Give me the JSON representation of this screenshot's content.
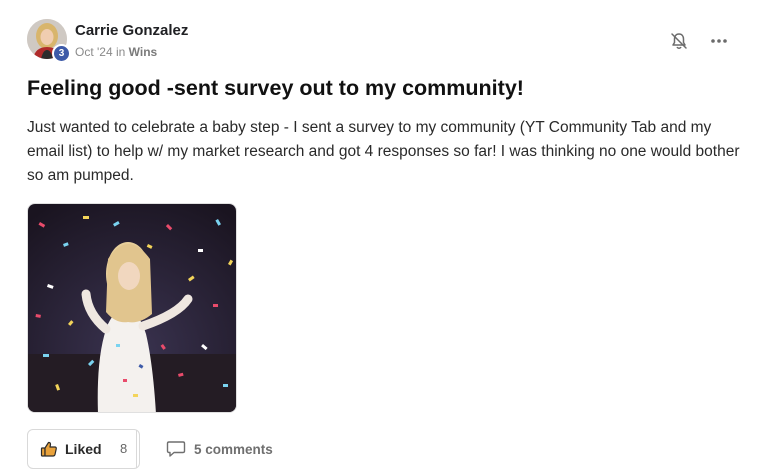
{
  "post": {
    "author": "Carrie Gonzalez",
    "level": "3",
    "date": "Oct '24",
    "in_word": "in",
    "category": "Wins",
    "title": "Feeling good -sent survey out to my community!",
    "body": "Just wanted to celebrate a baby step - I sent a survey to my community (YT Community Tab and my email list) to help w/ my market research and got 4 responses so far! I was thinking no one would bother so am pumped."
  },
  "actions": {
    "like_label": "Liked",
    "like_count": "8",
    "comments_label": "5 comments"
  },
  "icons": {
    "notification": "bell-off-icon",
    "more": "more-horizontal-icon",
    "like": "thumbs-up-icon",
    "comment": "comment-bubble-icon"
  },
  "colors": {
    "level_badge": "#3d5aa8",
    "like_thumb": "#e9a23b"
  }
}
